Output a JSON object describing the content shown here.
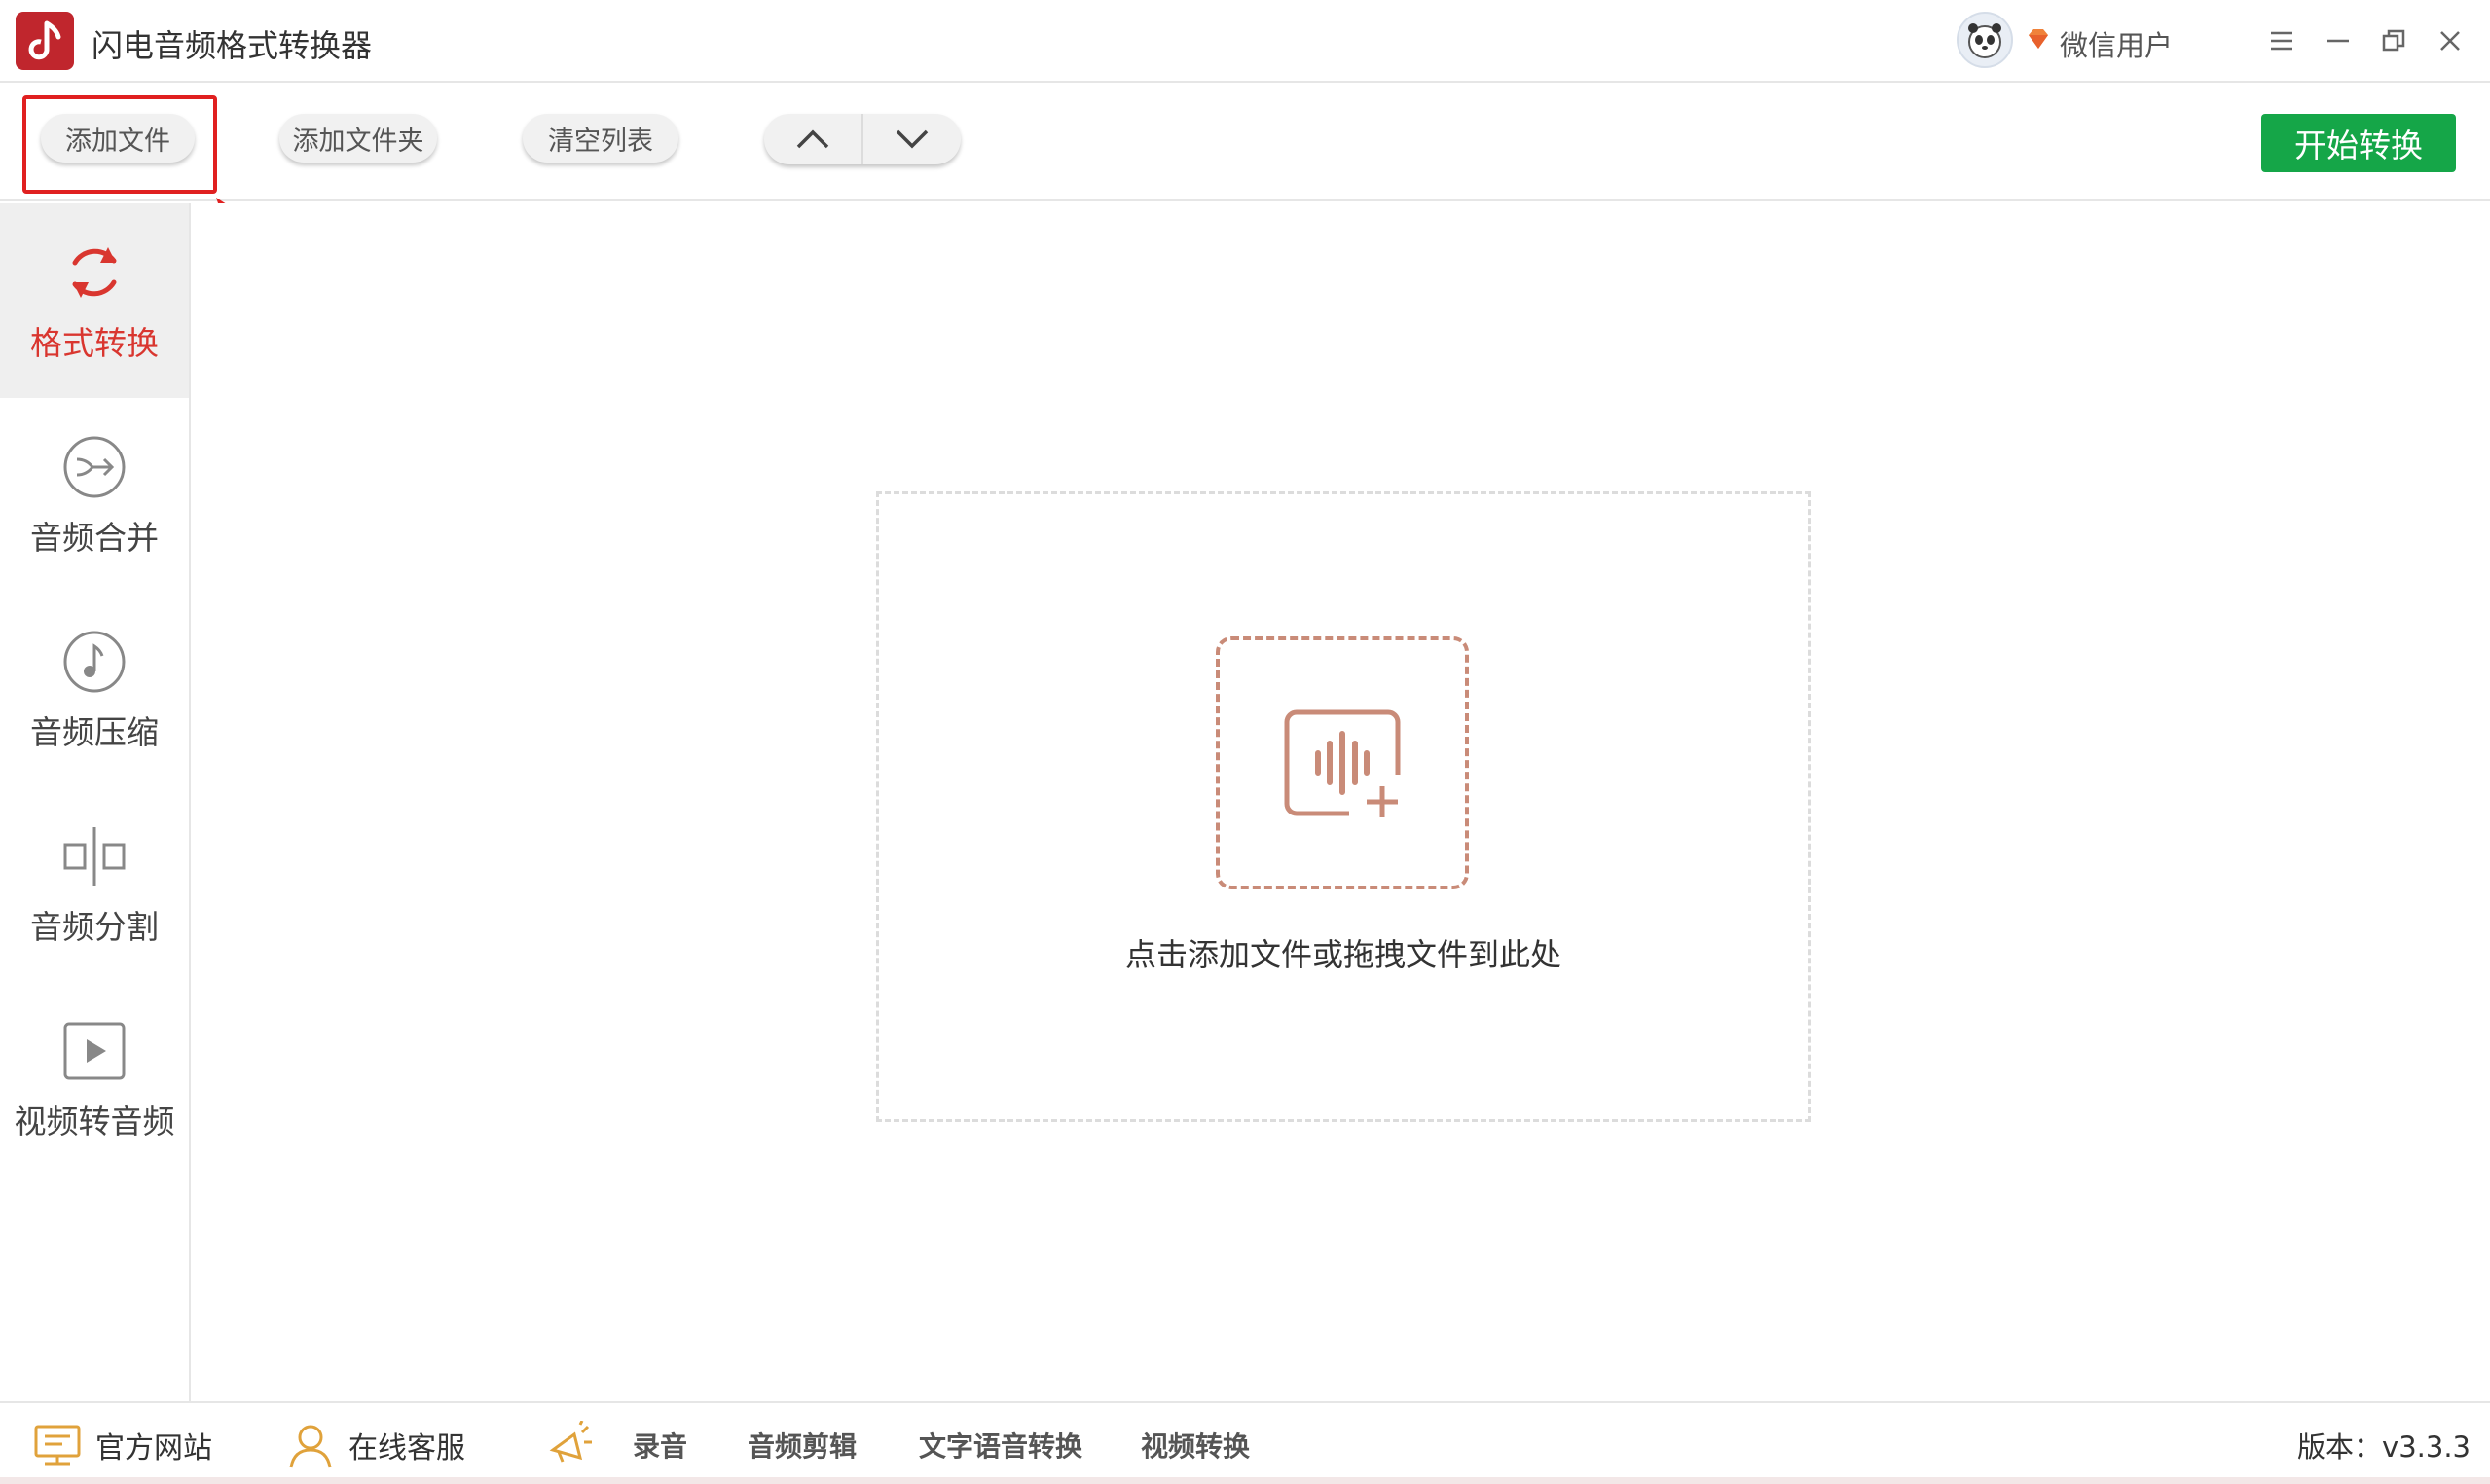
{
  "app": {
    "title": "闪电音频格式转换器",
    "user_name": "微信用户"
  },
  "toolbar": {
    "add_file": "添加文件",
    "add_folder": "添加文件夹",
    "clear_list": "清空列表",
    "start_convert": "开始转换"
  },
  "sidebar": {
    "items": [
      {
        "label": "格式转换",
        "icon": "refresh-icon",
        "active": true
      },
      {
        "label": "音频合并",
        "icon": "merge-icon",
        "active": false
      },
      {
        "label": "音频压缩",
        "icon": "music-note-icon",
        "active": false
      },
      {
        "label": "音频分割",
        "icon": "split-icon",
        "active": false
      },
      {
        "label": "视频转音频",
        "icon": "video-play-icon",
        "active": false
      }
    ]
  },
  "main": {
    "drop_text": "点击添加文件或拖拽文件到此处"
  },
  "footer": {
    "website": "官方网站",
    "support": "在线客服",
    "record": "录音",
    "audio_edit": "音频剪辑",
    "tts": "文字语音转换",
    "video_convert": "视频转换",
    "version": "版本：v3.3.3"
  },
  "colors": {
    "accent_red": "#d9362f",
    "start_green": "#15a648",
    "highlight_red": "#e02020",
    "drop_icon": "#c98b78"
  }
}
